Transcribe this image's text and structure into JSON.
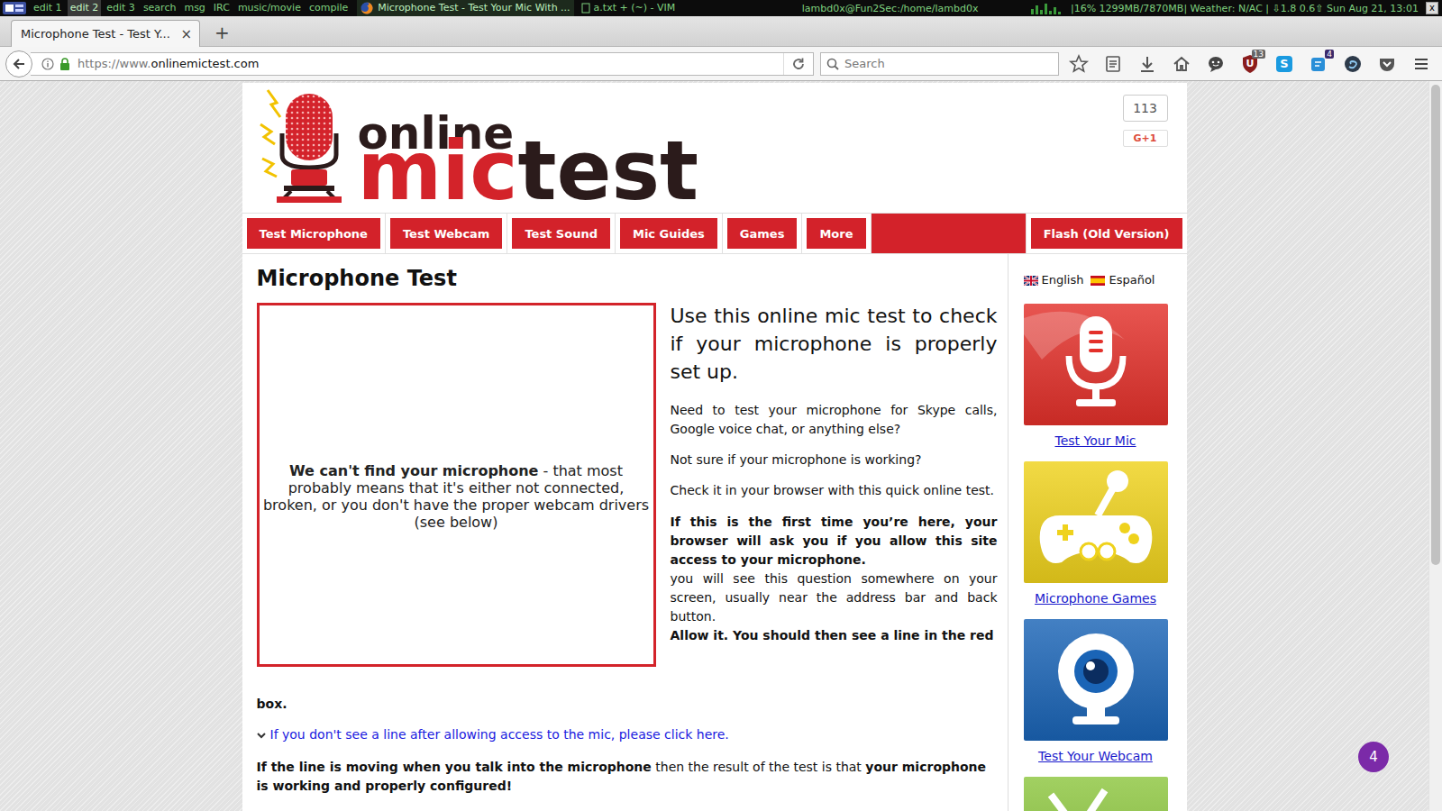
{
  "system_bar": {
    "tags": [
      {
        "label": "edit 1",
        "selected": false
      },
      {
        "label": "edit 2",
        "selected": true
      },
      {
        "label": "edit 3",
        "selected": false
      },
      {
        "label": "search",
        "selected": false
      },
      {
        "label": "msg",
        "selected": false
      },
      {
        "label": "IRC",
        "selected": false
      },
      {
        "label": "music/movie",
        "selected": false
      },
      {
        "label": "compile",
        "selected": false
      }
    ],
    "windows": [
      {
        "label": "Microphone Test - Test Your Mic With ...",
        "kind": "browser",
        "selected": true
      },
      {
        "label": "a.txt + (~) - VIM",
        "kind": "editor",
        "selected": false
      }
    ],
    "title": "lambd0x@Fun2Sec:/home/lambd0x",
    "status": "|16% 1299MB/7870MB| Weather: N/AC | ⇩1.8 0.6⇧ Sun Aug 21, 13:01",
    "close": "x"
  },
  "browser": {
    "tabs": [
      {
        "label": "Microphone Test - Test Y...",
        "close": "×",
        "selected": true
      }
    ],
    "new_tab": "+",
    "url": {
      "prefix": "https://www.",
      "host": "onlinemictest.com"
    },
    "search": {
      "placeholder": "Search"
    },
    "extensions": {
      "ublock_letter": "U",
      "ublock_badge": "13",
      "skype_letter": "S",
      "notes_badge": "4"
    }
  },
  "page": {
    "logo": {
      "top": "online",
      "red": "mic",
      "dark": "test"
    },
    "social": {
      "count": "113",
      "button": "G+1"
    },
    "menu": [
      {
        "label": "Test Microphone"
      },
      {
        "label": "Test Webcam"
      },
      {
        "label": "Test Sound"
      },
      {
        "label": "Mic Guides"
      },
      {
        "label": "Games"
      },
      {
        "label": "More"
      }
    ],
    "menu_right": "Flash (Old Version)",
    "heading": "Microphone Test",
    "mic_box": {
      "strong": "We can't find your microphone",
      "rest": " - that most probably means that it's either not connected, broken, or you don't have the proper webcam drivers (see below)"
    },
    "intro": "Use this online mic test to check if your microphone is properly set up.",
    "paragraphs": [
      "Need to test your microphone for Skype calls, Google voice chat, or anything else?",
      "Not sure if your microphone is working?",
      "Check it in your browser with this quick online test."
    ],
    "permission": {
      "bold": "If this is the first time you’re here, your browser will ask you if you allow this site access to your microphone.",
      "normal": "you will see this question somewhere on your screen, usually near the address bar and back button.",
      "allow": "Allow it. You should then see a line in the red",
      "allow_tail": "box."
    },
    "help_link": "If you don't see a line after allowing access to the mic, please click here.",
    "result": [
      {
        "text": "If the line is moving when you talk into the microphone",
        "bold": true
      },
      {
        "text": " then the result of the test is that ",
        "bold": false
      },
      {
        "text": "your microphone is working and properly configured!",
        "bold": true
      }
    ],
    "languages": [
      {
        "label": "English",
        "kind": "uk"
      },
      {
        "label": "Español",
        "kind": "es"
      }
    ],
    "cards": [
      {
        "label": "Test Your Mic",
        "kind": "mic",
        "color": "#e3302a"
      },
      {
        "label": "Microphone Games",
        "kind": "games",
        "color": "#efd21c"
      },
      {
        "label": "Test Your Webcam",
        "kind": "webcam",
        "color": "#1a64b6"
      },
      {
        "kind": "partial",
        "color": "#8dc63f"
      }
    ]
  },
  "chat_badge": "4"
}
